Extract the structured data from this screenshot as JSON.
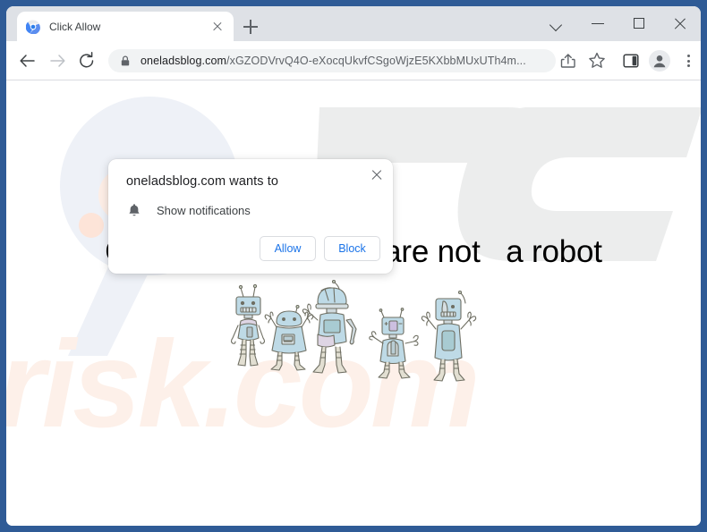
{
  "window": {
    "controls": [
      {
        "name": "tab-search-chevron",
        "glyph": "chevron-down-icon"
      },
      {
        "name": "minimize",
        "glyph": "minimize-icon"
      },
      {
        "name": "maximize",
        "glyph": "maximize-icon"
      },
      {
        "name": "close",
        "glyph": "close-icon"
      }
    ],
    "border_color": "#2f5b96"
  },
  "tabstrip": {
    "tab": {
      "title": "Click Allow",
      "favicon": "chrome-logo-icon",
      "close_icon": "close-icon"
    },
    "new_tab_icon": "plus-icon"
  },
  "toolbar": {
    "back_icon": "arrow-left-icon",
    "forward_icon": "arrow-right-icon",
    "reload_icon": "reload-icon",
    "lock_icon": "lock-icon",
    "url_host": "oneladsblog.com",
    "url_path": "/xGZODVrvQ4O-eXocqUkvfCSgoWjzE5KXbbMUxUTh4m...",
    "url_full": "oneladsblog.com/xGZODVrvQ4O-eXocqUkvfCSgoWjzE5KXbbMUxUTh4m...",
    "share_icon": "share-icon",
    "bookmark_icon": "star-icon",
    "side_panel_icon": "side-panel-icon",
    "profile_icon": "profile-avatar-icon",
    "menu_icon": "three-dot-menu-icon"
  },
  "permission_popup": {
    "title": "oneladsblog.com wants to",
    "permission_icon": "bell-icon",
    "permission_label": "Show notifications",
    "allow_label": "Allow",
    "block_label": "Block",
    "close_icon": "close-icon",
    "link_color": "#1a73e8"
  },
  "page": {
    "headline": "Click \"Allow\"   if you are not   a robot",
    "illustration": "five-cartoon-robots-waving",
    "watermark_text": "risk.com",
    "watermark_logo": "pc-logo-watermark",
    "background_color": "#ffffff"
  }
}
